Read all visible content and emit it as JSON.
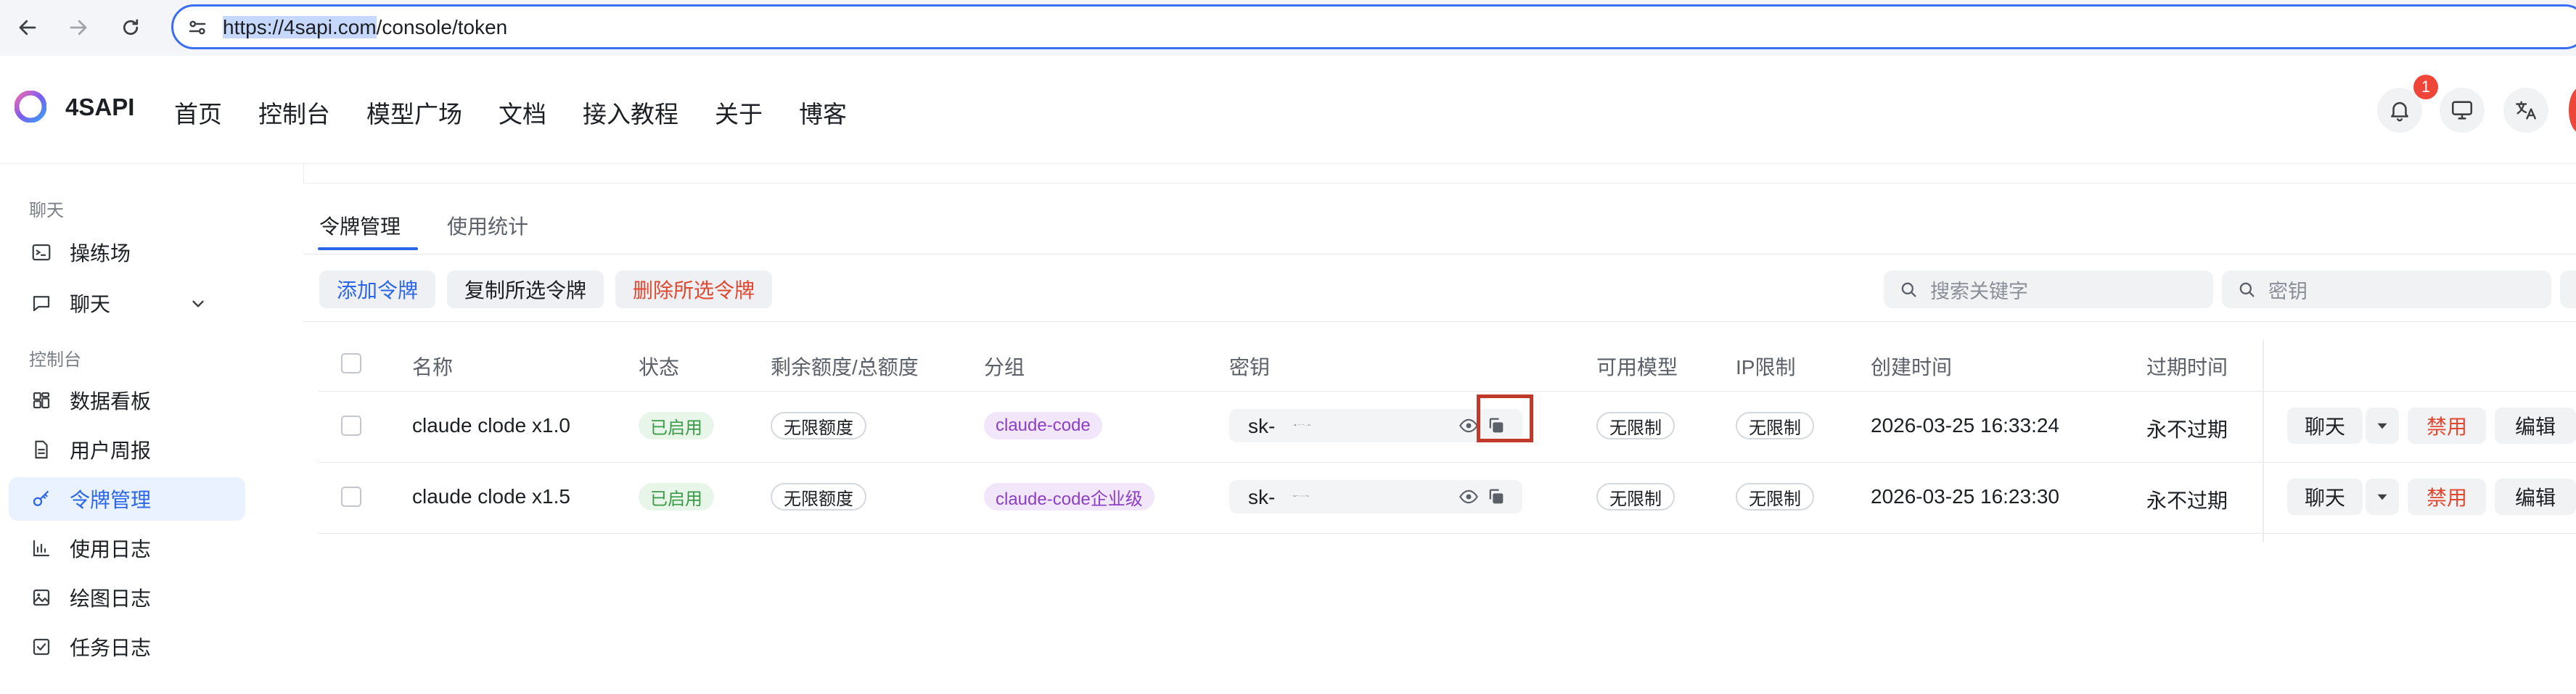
{
  "browser": {
    "url_highlight": "https://4sapi.com",
    "url_rest": "/console/token"
  },
  "header": {
    "brand": "4SAPI",
    "nav": [
      "首页",
      "控制台",
      "模型广场",
      "文档",
      "接入教程",
      "关于",
      "博客"
    ],
    "notification_count": "1",
    "icons": [
      "bell-icon",
      "monitor-icon",
      "translate-icon"
    ]
  },
  "sidebar": {
    "section_chat": "聊天",
    "chat_items": [
      {
        "label": "操练场",
        "icon": "terminal-icon"
      },
      {
        "label": "聊天",
        "icon": "chat-icon"
      }
    ],
    "section_console": "控制台",
    "console_items": [
      {
        "label": "数据看板",
        "icon": "dashboard-icon"
      },
      {
        "label": "用户周报",
        "icon": "document-icon"
      },
      {
        "label": "令牌管理",
        "icon": "key-icon",
        "active": true
      },
      {
        "label": "使用日志",
        "icon": "bar-chart-icon"
      },
      {
        "label": "绘图日志",
        "icon": "image-icon"
      },
      {
        "label": "任务日志",
        "icon": "checkbox-icon"
      }
    ]
  },
  "main": {
    "tabs": [
      "令牌管理",
      "使用统计"
    ],
    "actions": {
      "add": "添加令牌",
      "copy": "复制所选令牌",
      "delete": "删除所选令牌"
    },
    "search_keyword_placeholder": "搜索关键字",
    "search_key_placeholder": "密钥",
    "columns": [
      "名称",
      "状态",
      "剩余额度/总额度",
      "分组",
      "密钥",
      "可用模型",
      "IP限制",
      "创建时间",
      "过期时间"
    ],
    "rows": [
      {
        "name": "claude clode x1.0",
        "status": "已启用",
        "quota": "无限额度",
        "group": "claude-code",
        "key_prefix": "sk-",
        "models": "无限制",
        "ip": "无限制",
        "created": "2026-03-25 16:33:24",
        "expire": "永不过期"
      },
      {
        "name": "claude clode x1.5",
        "status": "已启用",
        "quota": "无限额度",
        "group": "claude-code企业级",
        "key_prefix": "sk-",
        "models": "无限制",
        "ip": "无限制",
        "created": "2026-03-25 16:23:30",
        "expire": "永不过期"
      }
    ],
    "row_ops": {
      "chat": "聊天",
      "disable": "禁用",
      "edit": "编辑"
    }
  },
  "colors": {
    "accent": "#2b66e8",
    "danger": "#e2472f",
    "highlight_box": "#c0392b"
  }
}
